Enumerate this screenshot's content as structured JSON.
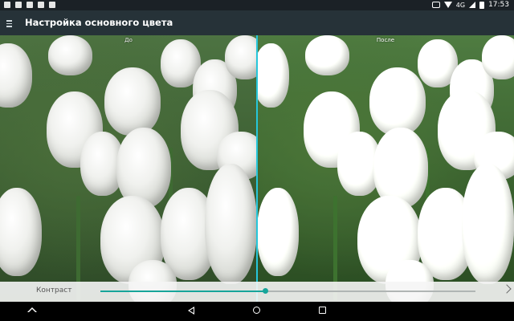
{
  "status_bar": {
    "icons_left": [
      "image-icon",
      "notification-icon",
      "lock-icon",
      "download-icon",
      "gallery-icon"
    ],
    "network": "4G",
    "time": "17:53"
  },
  "app_bar": {
    "title": "Настройка основного цвета"
  },
  "preview": {
    "before_label": "До",
    "after_label": "После"
  },
  "control": {
    "label": "Контраст",
    "value": 0.44,
    "accent_color": "#17a59a"
  },
  "colors": {
    "app_bar": "#263238",
    "divider": "#26c6da"
  }
}
